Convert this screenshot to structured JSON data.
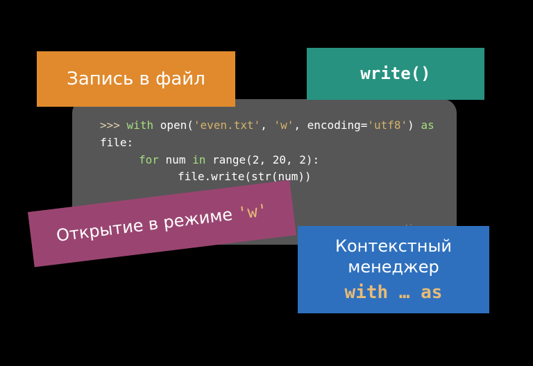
{
  "badges": {
    "orange": "Запись в файл",
    "teal": "write()",
    "plum_prefix": "Открытие в режиме ",
    "plum_mono_open": "'",
    "plum_mono_w": "w",
    "plum_mono_close": "'",
    "blue_line1": "Контекстный",
    "blue_line2": "менеджер",
    "blue_mono": "with … as"
  },
  "code": {
    "prompt": ">>>",
    "kw_with": "with",
    "fn_open": "open",
    "paren_open": "(",
    "str_file": "'even.txt'",
    "comma1": ", ",
    "str_mode": "'w'",
    "comma2": ", ",
    "arg_enc": "encoding=",
    "str_enc": "'utf8'",
    "paren_close": ")",
    "kw_as": "as",
    "var_file": "file:",
    "kw_for": "for",
    "var_num": "num",
    "kw_in": "in",
    "fn_range": "range",
    "range_args": "(2, 20, 2):",
    "line3": "file.write(str(num))"
  },
  "watermark": "smartiqa.ru"
}
